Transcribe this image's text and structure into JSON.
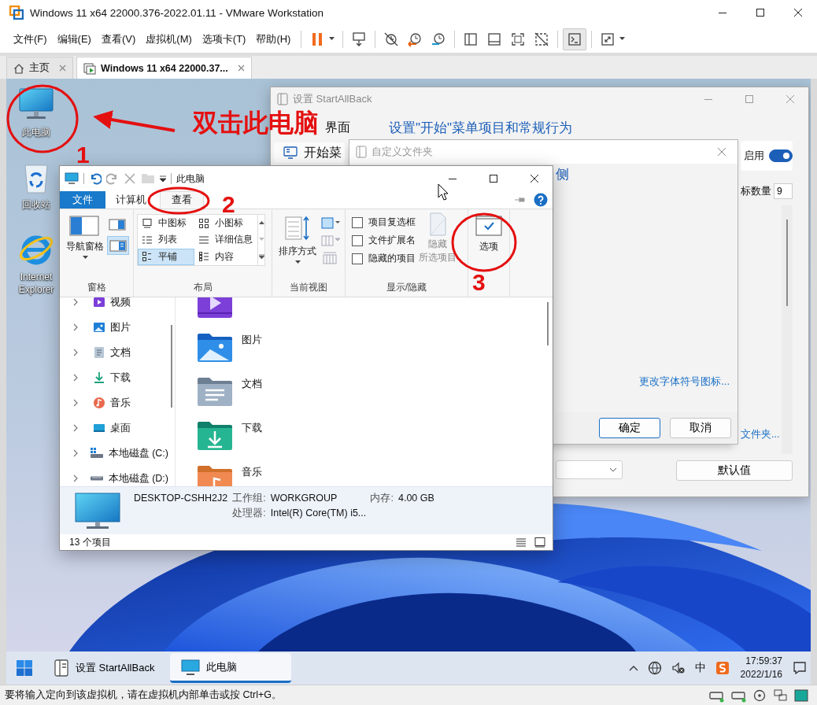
{
  "window": {
    "title": "Windows 11 x64 22000.376-2022.01.11 - VMware Workstation"
  },
  "menu": [
    "文件(F)",
    "编辑(E)",
    "查看(V)",
    "虚拟机(M)",
    "选项卡(T)",
    "帮助(H)"
  ],
  "tabs": [
    {
      "label": "主页",
      "selected": false
    },
    {
      "label": "Windows 11 x64 22000.37...",
      "selected": true
    }
  ],
  "desktop_icons": [
    {
      "kind": "computer",
      "label": "此电脑"
    },
    {
      "kind": "recycle_bin",
      "label": "回收站"
    },
    {
      "kind": "browser",
      "label": "Internet Explorer"
    }
  ],
  "annotations": {
    "instruction": "双击此电脑",
    "steps": [
      "1",
      "2",
      "3"
    ]
  },
  "startallback": {
    "title": "设置 StartAllBack",
    "sidebar": [
      "界面",
      "开始菜"
    ],
    "heading": "设置\"开始\"菜单项目和常规行为",
    "subheading": "侧",
    "toggle": {
      "label": "启用",
      "on": true
    },
    "count": {
      "label": "标数量",
      "value": "9"
    },
    "link": "文件夹...",
    "reset_button": "默认值"
  },
  "customize_dialog": {
    "title": "自定义文件夹",
    "link": "更改字体符号图标...",
    "buttons": [
      {
        "label": "确定",
        "default": true
      },
      {
        "label": "取消",
        "default": false
      }
    ]
  },
  "explorer": {
    "title": "此电脑",
    "ribbon_tabs": [
      {
        "label": "文件",
        "kind": "file",
        "selected": false
      },
      {
        "label": "计算机",
        "kind": "tab",
        "selected": false
      },
      {
        "label": "查看",
        "kind": "tab",
        "selected": true
      }
    ],
    "panes": {
      "nav_pane": "导航窗格",
      "group": "窗格"
    },
    "layout": {
      "items": [
        {
          "kind": "medium",
          "label": "中图标",
          "selected": false
        },
        {
          "kind": "small",
          "label": "小图标",
          "selected": false
        },
        {
          "kind": "list",
          "label": "列表",
          "selected": false
        },
        {
          "kind": "details",
          "label": "详细信息",
          "selected": false
        },
        {
          "kind": "tiles",
          "label": "平铺",
          "selected": true
        },
        {
          "kind": "content",
          "label": "内容",
          "selected": false
        }
      ],
      "group": "布局"
    },
    "current_view": {
      "sort": "排序方式",
      "group": "当前视图"
    },
    "show_hide": {
      "checkboxes": [
        {
          "label": "项目复选框",
          "checked": false
        },
        {
          "label": "文件扩展名",
          "checked": false
        },
        {
          "label": "隐藏的项目",
          "checked": false
        }
      ],
      "hide_selected": [
        "隐藏",
        "所选项目"
      ],
      "group": "显示/隐藏"
    },
    "options": "选项",
    "nav": [
      {
        "kind": "video",
        "label": "视频"
      },
      {
        "kind": "pictures",
        "label": "图片"
      },
      {
        "kind": "documents",
        "label": "文档"
      },
      {
        "kind": "downloads",
        "label": "下载"
      },
      {
        "kind": "music",
        "label": "音乐"
      },
      {
        "kind": "desktop",
        "label": "桌面"
      },
      {
        "kind": "system_drive",
        "label": "本地磁盘 (C:)"
      },
      {
        "kind": "drive",
        "label": "本地磁盘 (D:)"
      }
    ],
    "items": [
      {
        "kind": "video"
      },
      {
        "kind": "pictures",
        "label": "图片"
      },
      {
        "kind": "documents",
        "label": "文档"
      },
      {
        "kind": "downloads",
        "label": "下载"
      },
      {
        "kind": "music",
        "label": "音乐"
      }
    ],
    "details": {
      "name": "DESKTOP-CSHH2J2",
      "fields": [
        {
          "label": "工作组:",
          "value": "WORKGROUP"
        },
        {
          "label": "内存:",
          "value": "4.00 GB"
        },
        {
          "label": "处理器:",
          "value": "Intel(R) Core(TM) i5..."
        }
      ]
    },
    "status": "13 个项目"
  },
  "taskbar": {
    "apps": [
      {
        "kind": "settings",
        "label": "设置 StartAllBack",
        "selected": false
      },
      {
        "kind": "computer",
        "label": "此电脑",
        "selected": true
      }
    ],
    "ime": "中",
    "time": "17:59:37",
    "date": "2022/1/16"
  },
  "status_bar": "要将输入定向到该虚拟机，请在虚拟机内部单击或按 Ctrl+G。"
}
